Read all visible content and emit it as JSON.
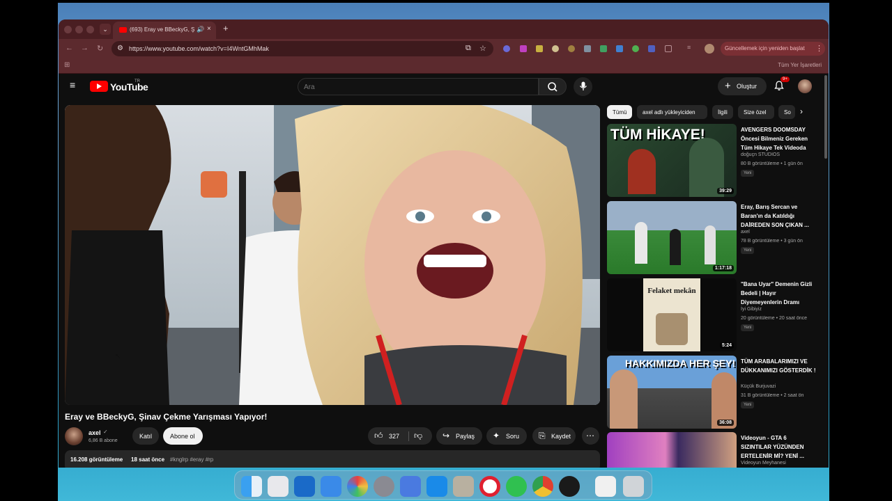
{
  "browser": {
    "tab_title": "(693) Eray ve BBeckyG, Ş",
    "tab_audio_icon": "speaker-icon",
    "url": "https://www.youtube.com/watch?v=I4WntGMhMak",
    "update_label": "Güncellemek için yeniden başlat",
    "all_bookmarks": "Tüm Yer İşaretleri"
  },
  "youtube": {
    "logo_text": "YouTube",
    "region": "TR",
    "search_placeholder": "Ara",
    "create_label": "Oluştur",
    "notif_count": "9+"
  },
  "video": {
    "title": "Eray ve BBeckyG, Şinav Çekme Yarışması Yapıyor!",
    "channel": "axel",
    "subscribers": "6,86 B abone",
    "join_label": "Katıl",
    "subscribe_label": "Abone ol",
    "likes": "327",
    "share_label": "Paylaş",
    "ask_label": "Soru",
    "save_label": "Kaydet",
    "views": "16.208 görüntüleme",
    "time": "18 saat önce",
    "tags": "#knglrp #eray #rp"
  },
  "chips": [
    "Tümü",
    "axel adlı yükleyiciden",
    "İlgili",
    "Size özel",
    "So"
  ],
  "recommendations": [
    {
      "title": "AVENGERS DOOMSDAY Öncesi Bilmeniz Gereken Tüm Hikaye Tek Videoda",
      "channel": "doğuçn STUDIOS",
      "meta": "80 B görüntüleme • 1 gün ön",
      "badge": "Yeni",
      "duration": "39:29",
      "thumb_text": "TÜM HİKAYE!"
    },
    {
      "title": "Eray, Barış Sercan ve Baran'ın da Katıldığı DAİREDEN SON ÇIKAN ...",
      "channel": "axel",
      "meta": "78 B görüntüleme • 3 gün ön",
      "badge": "Yeni",
      "duration": "1:17:18",
      "thumb_text": ""
    },
    {
      "title": "\"Bana Uyar\" Demenin Gizli Bedeli | Hayır Diyemeyenlerin Dramı",
      "channel": "İyi Gibiyiz",
      "meta": "20 görüntüleme • 20 saat önce",
      "badge": "Yeni",
      "duration": "5:24",
      "thumb_text": "Felaket mekân"
    },
    {
      "title": "TÜM ARABALARIMIZI VE DÜKKANIMIZI GÖSTERDİK !",
      "channel": "Küçük Burjuvazi",
      "meta": "31 B görüntüleme • 2 saat ön",
      "badge": "Yeni",
      "duration": "36:08",
      "thumb_text": "HAKKIMIZDA HER ŞEY!"
    },
    {
      "title": "Videoyun - GTA 6 SIZINTILAR YÜZÜNDEN ERTELENİR Mİ? YENİ ...",
      "channel": "Videoyun Meyhanesi",
      "meta": "",
      "badge": "",
      "duration": "",
      "thumb_text": ""
    }
  ],
  "colors": {
    "accent": "#ff0000",
    "tabbar": "#4a1e22",
    "toolbar": "#5c2a2e",
    "yt_bg": "#0f0f0f"
  }
}
